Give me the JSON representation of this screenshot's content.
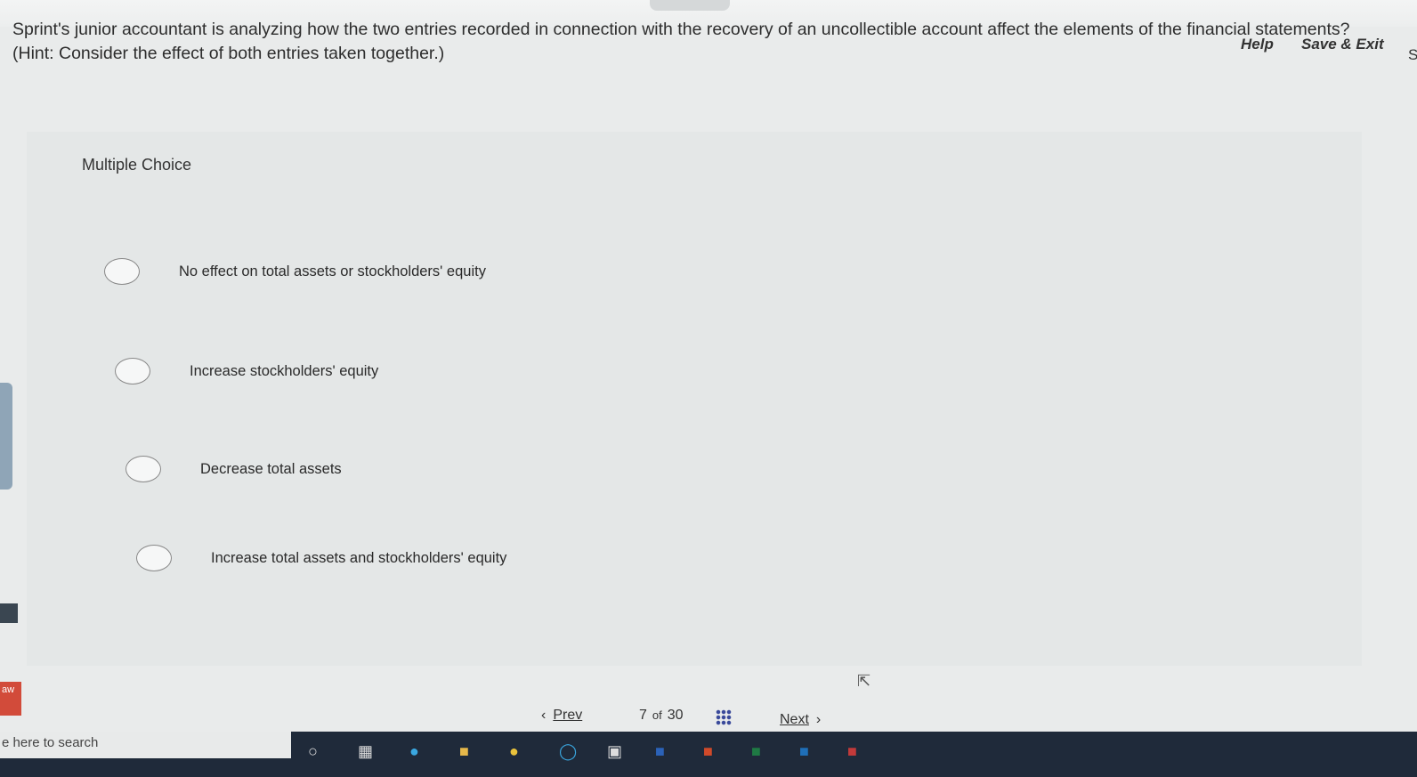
{
  "header": {
    "help_label": "Help",
    "save_exit_label": "Save & Exit",
    "cut_label": "S"
  },
  "question": {
    "text": "Sprint's junior accountant is analyzing how the two entries recorded in connection with the recovery of an uncollectible account affect the elements of the financial statements? (Hint: Consider the effect of both entries taken together.)"
  },
  "multiple_choice_label": "Multiple Choice",
  "choices": [
    {
      "label": "No effect on total assets or stockholders' equity"
    },
    {
      "label": "Increase stockholders' equity"
    },
    {
      "label": "Decrease total assets"
    },
    {
      "label": "Increase total assets and stockholders' equity"
    }
  ],
  "navigation": {
    "prev_label": "Prev",
    "current_page": "7",
    "of_label": "of",
    "total_pages": "30",
    "next_label": "Next"
  },
  "taskbar": {
    "search_placeholder": "e here to search",
    "pinned_badge": "aw"
  },
  "icons": {
    "prev": "chevron-left-icon",
    "next": "chevron-right-icon",
    "grid": "grid-icon",
    "cursor": "mouse-cursor-icon"
  }
}
